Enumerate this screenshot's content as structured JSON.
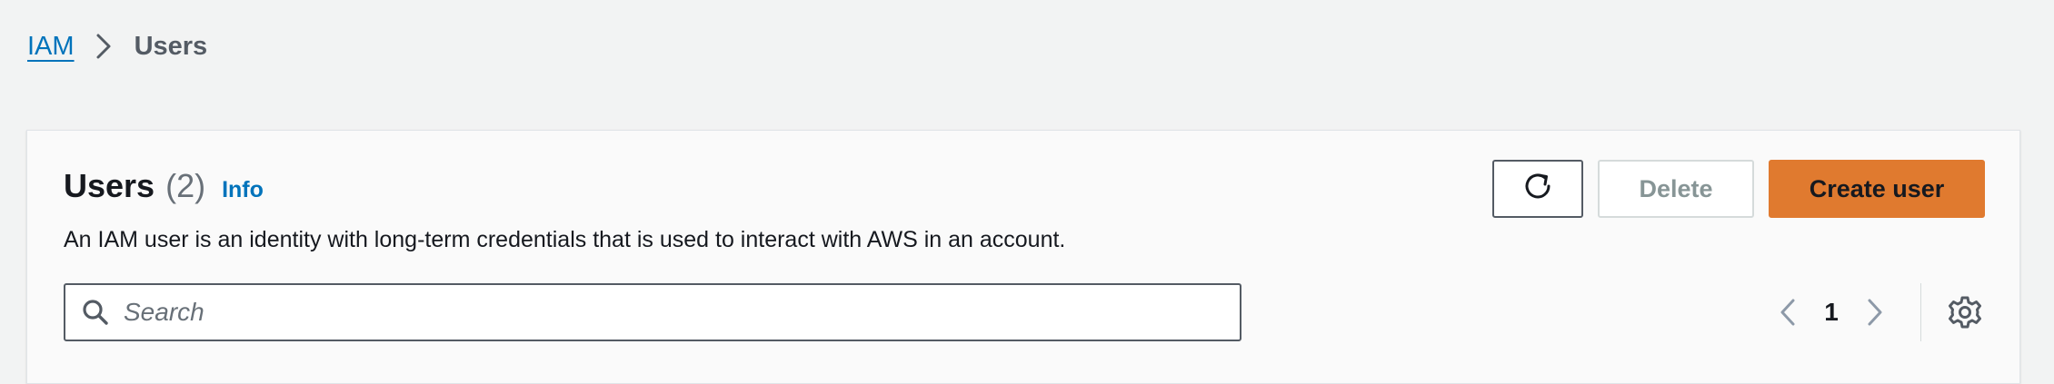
{
  "breadcrumb": {
    "root": "IAM",
    "current": "Users"
  },
  "panel": {
    "title": "Users",
    "count": "(2)",
    "info": "Info",
    "description": "An IAM user is an identity with long-term credentials that is used to interact with AWS in an account."
  },
  "actions": {
    "refresh_icon": "refresh-icon",
    "delete_label": "Delete",
    "create_label": "Create user"
  },
  "search": {
    "placeholder": "Search",
    "value": "",
    "icon": "search-icon"
  },
  "pagination": {
    "current_page": "1",
    "prev_icon": "chevron-left-icon",
    "next_icon": "chevron-right-icon",
    "settings_icon": "gear-icon"
  },
  "colors": {
    "link": "#0073bb",
    "primary_button": "#e07a2f",
    "background": "#f2f3f3",
    "panel": "#fafafa",
    "disabled_text": "#879596"
  }
}
